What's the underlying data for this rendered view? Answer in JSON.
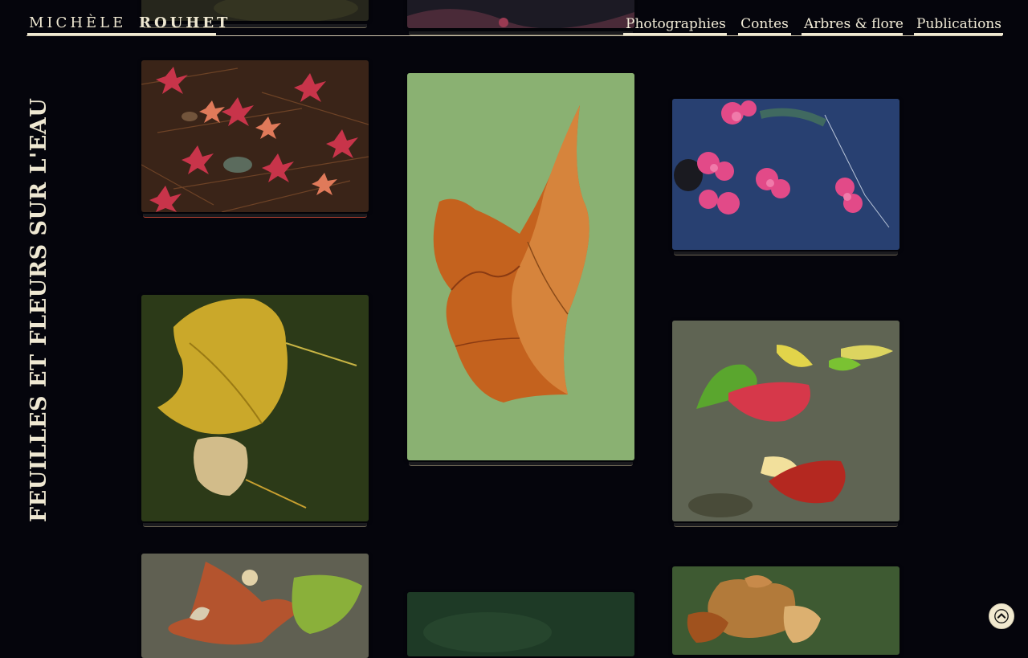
{
  "site": {
    "author_first": "MICHÈLE",
    "author_last": "ROUHET"
  },
  "nav": {
    "items": [
      {
        "label": "Photographies"
      },
      {
        "label": "Contes"
      },
      {
        "label": "Arbres & flore"
      },
      {
        "label": "Publications"
      }
    ]
  },
  "page": {
    "title": "FEUILLES ET FLEURS SUR L'EAU"
  },
  "gallery": {
    "photos": [
      {
        "name": "photo-red-maple-leaves-on-pine-needles",
        "subject": "red maple leaves on pine needles"
      },
      {
        "name": "photo-brown-leaf-on-green-water",
        "subject": "curled brown leaf floating on green water"
      },
      {
        "name": "photo-pink-flowers-on-blue-water",
        "subject": "pink flowers floating on dark blue water"
      },
      {
        "name": "photo-yellow-leaves-on-dark-water",
        "subject": "yellow leaves on dark green water"
      },
      {
        "name": "photo-colored-leaves-on-grey-water",
        "subject": "green red and yellow leaves on grey water"
      },
      {
        "name": "photo-autumn-leaves-on-water",
        "subject": "autumn leaves on water"
      },
      {
        "name": "photo-dark-green-water",
        "subject": "dark green water"
      },
      {
        "name": "photo-brown-leaves-cluster",
        "subject": "brown leaves cluster on water"
      }
    ]
  },
  "controls": {
    "scroll_top_icon": "chevron-up-icon"
  }
}
